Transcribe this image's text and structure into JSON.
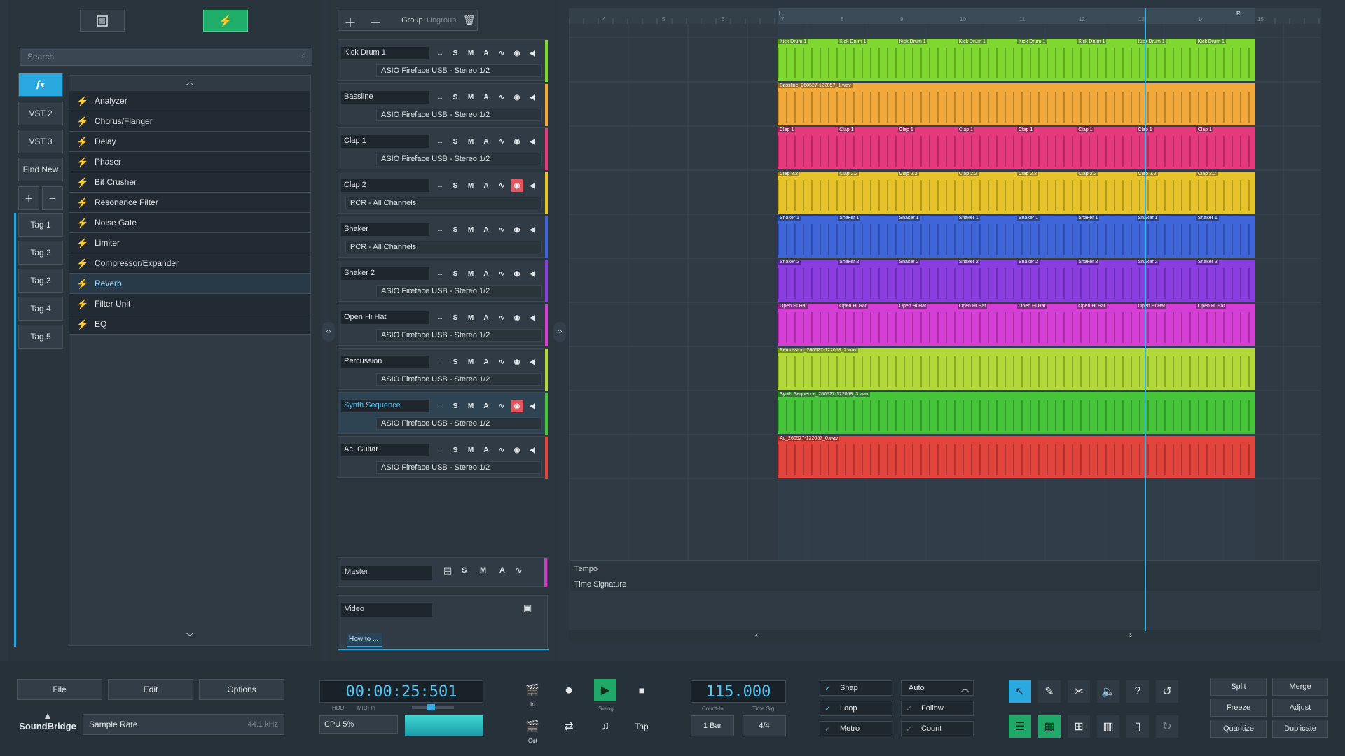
{
  "browser": {
    "search_placeholder": "Search",
    "side_tabs": [
      "VST 2",
      "VST 3",
      "Find New"
    ],
    "fx_label": "fx",
    "tags": [
      "Tag 1",
      "Tag 2",
      "Tag 3",
      "Tag 4",
      "Tag 5"
    ],
    "plugins": [
      "Analyzer",
      "Chorus/Flanger",
      "Delay",
      "Phaser",
      "Bit Crusher",
      "Resonance Filter",
      "Noise Gate",
      "Limiter",
      "Compressor/Expander",
      "Reverb",
      "Filter Unit",
      "EQ"
    ],
    "selected_plugin": "Reverb"
  },
  "track_toolbar": {
    "group": "Group",
    "ungroup": "Ungroup"
  },
  "tracks": [
    {
      "name": "Kick Drum 1",
      "io": "ASIO Fireface USB - Stereo 1/2",
      "color": "#7fd82f"
    },
    {
      "name": "Bassline",
      "io": "ASIO Fireface USB - Stereo 1/2",
      "color": "#f2a93b"
    },
    {
      "name": "Clap 1",
      "io": "ASIO Fireface USB - Stereo 1/2",
      "color": "#e43a7d"
    },
    {
      "name": "Clap 2",
      "io": "PCR - All Channels",
      "color": "#e6c32a"
    },
    {
      "name": "Shaker",
      "io": "PCR - All Channels",
      "color": "#3f66d8"
    },
    {
      "name": "Shaker 2",
      "io": "ASIO Fireface USB - Stereo 1/2",
      "color": "#8a3ee0"
    },
    {
      "name": "Open Hi Hat",
      "io": "ASIO Fireface USB - Stereo 1/2",
      "color": "#d53fd6"
    },
    {
      "name": "Percussion",
      "io": "ASIO Fireface USB - Stereo 1/2",
      "color": "#b3d83a"
    },
    {
      "name": "Synth Sequence",
      "io": "ASIO Fireface USB - Stereo 1/2",
      "color": "#46c43a"
    },
    {
      "name": "Ac. Guitar",
      "io": "ASIO Fireface USB - Stereo 1/2",
      "color": "#e0443d"
    }
  ],
  "master": {
    "name": "Master"
  },
  "video": {
    "name": "Video",
    "howto": "How to ..."
  },
  "ruler": {
    "numbers": [
      "4",
      "5",
      "6",
      "7",
      "8",
      "9",
      "10",
      "11",
      "12",
      "13",
      "14",
      "15"
    ],
    "loop_start": "L",
    "loop_end": "R"
  },
  "clips": {
    "kick": "Kick Drum 1",
    "bass": "Bassline_260527-122057_1.wav",
    "clap1": "Clap 1",
    "clap2": "Clap 2.2",
    "shaker": "Shaker 1",
    "shaker2": "Shaker 2",
    "ohh": "Open Hi Hat",
    "perc": "Percussion_260527-122058_2.wav",
    "synth": "Synth Sequence_260527-122058_3.wav",
    "guitar": "Ac_260527-122057_0.wav"
  },
  "lanes": {
    "tempo": "Tempo",
    "timesig": "Time Signature"
  },
  "transport": {
    "menu": [
      "File",
      "Edit",
      "Options"
    ],
    "logo": "SoundBridge",
    "sample_rate_label": "Sample Rate",
    "sample_rate": "44.1 kHz",
    "time": "00:00:25:501",
    "hdd": "HDD",
    "midi_in": "MIDI In",
    "cpu": "CPU 5%",
    "in": "In",
    "out": "Out",
    "swing": "Swing",
    "tap": "Tap",
    "tempo": "115.000",
    "count_in_label": "Count-In",
    "count_in": "1 Bar",
    "time_sig_label": "Time Sig",
    "time_sig": "4/4",
    "snap": "Snap",
    "loop": "Loop",
    "metro": "Metro",
    "auto": "Auto",
    "follow": "Follow",
    "count": "Count",
    "edit_buttons": [
      "Split",
      "Merge",
      "Freeze",
      "Adjust",
      "Quantize",
      "Duplicate"
    ]
  }
}
